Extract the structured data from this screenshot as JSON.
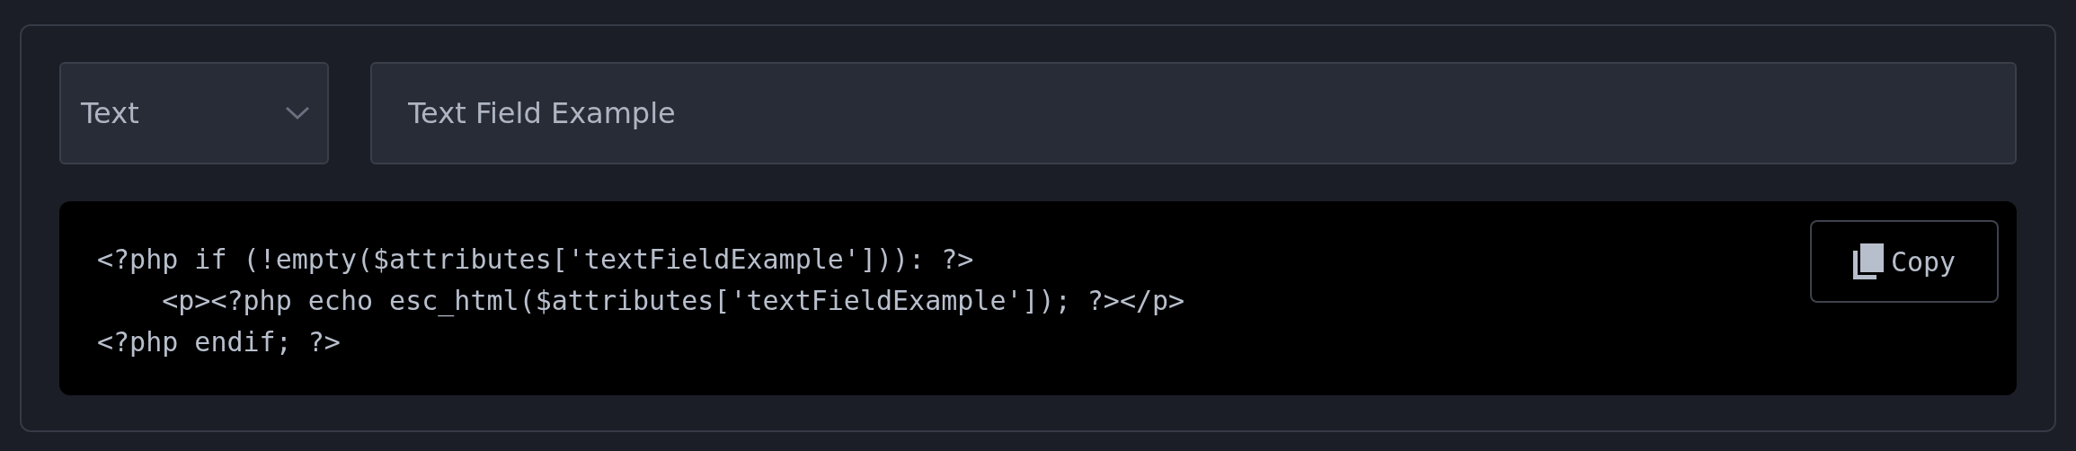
{
  "field_type_select": {
    "value": "Text"
  },
  "field_label_input": {
    "value": "Text Field Example"
  },
  "code": {
    "lines": [
      "<?php if (!empty($attributes['textFieldExample'])): ?>",
      "    <p><?php echo esc_html($attributes['textFieldExample']); ?></p>",
      "<?php endif; ?>"
    ],
    "copy_button": "Copy"
  }
}
